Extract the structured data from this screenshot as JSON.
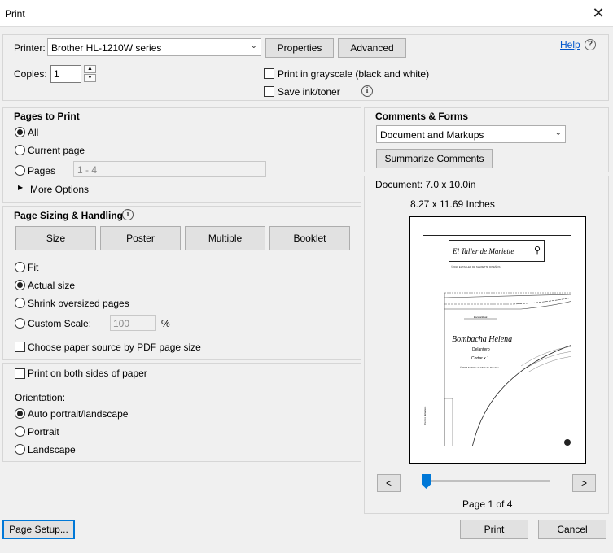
{
  "window": {
    "title": "Print",
    "close_glyph": "✕"
  },
  "printer": {
    "label": "Printer:",
    "selected": "Brother HL-1210W series",
    "properties_label": "Properties",
    "advanced_label": "Advanced",
    "help_label": "Help",
    "copies_label": "Copies:",
    "copies_value": "1",
    "grayscale_label": "Print in grayscale (black and white)",
    "grayscale_checked": false,
    "save_ink_label": "Save ink/toner",
    "save_ink_checked": false
  },
  "pages_to_print": {
    "heading": "Pages to Print",
    "all_label": "All",
    "current_label": "Current page",
    "pages_label": "Pages",
    "pages_range": "1 - 4",
    "more_options_label": "More Options",
    "selected": "all"
  },
  "sizing": {
    "heading": "Page Sizing & Handling",
    "buttons": [
      "Size",
      "Poster",
      "Multiple",
      "Booklet"
    ],
    "fit_label": "Fit",
    "actual_label": "Actual size",
    "shrink_label": "Shrink oversized pages",
    "custom_label": "Custom Scale:",
    "custom_value": "100",
    "percent": "%",
    "paper_source_label": "Choose paper source by PDF page size",
    "selected": "actual"
  },
  "duplex": {
    "both_sides_label": "Print on both sides of paper",
    "orientation_label": "Orientation:",
    "auto_label": "Auto portrait/landscape",
    "portrait_label": "Portrait",
    "landscape_label": "Landscape",
    "selected": "auto"
  },
  "comments": {
    "heading": "Comments & Forms",
    "selected": "Document and Markups",
    "summarize_label": "Summarize Comments"
  },
  "preview": {
    "document_size": "Document: 7.0 x 10.0in",
    "paper_size": "8.27 x 11.69 Inches",
    "prev_label": "<",
    "next_label": ">",
    "page_indicator": "Page 1 of 4",
    "page_position": 0.0,
    "sheet": {
      "title": "El Taller de Mariette",
      "copyright": "©2018 EL TALLER DE MARIETTE DISEÑOS",
      "name": "Bombacha Helena",
      "part": "Delantero",
      "cut": "Cortar x 1",
      "footer_credit": "©2018 El Taller de Mariette Diseños",
      "label_small": "Escala/Ideal",
      "side_text": "Centro delantero"
    }
  },
  "footer": {
    "page_setup_label": "Page Setup...",
    "print_label": "Print",
    "cancel_label": "Cancel"
  },
  "colors": {
    "accent": "#0078d7",
    "link": "#0055cc"
  }
}
